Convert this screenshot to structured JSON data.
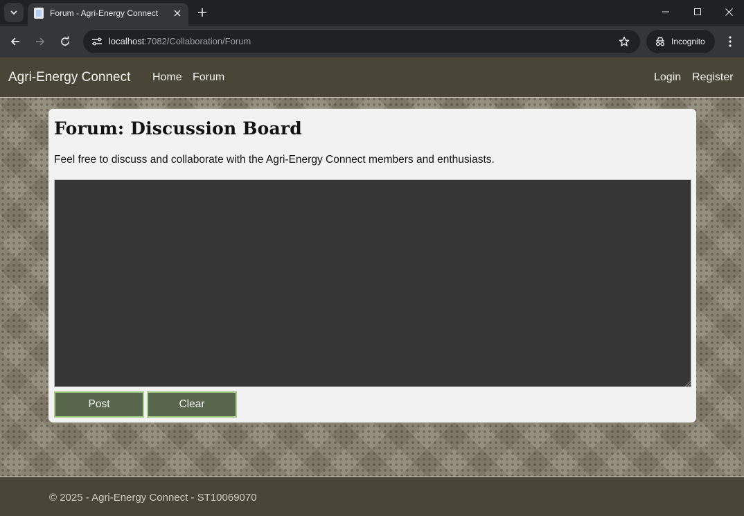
{
  "browser": {
    "tab_title": "Forum - Agri-Energy Connect",
    "url_host": "localhost",
    "url_rest": ":7082/Collaboration/Forum",
    "incognito_label": "Incognito"
  },
  "site": {
    "brand": "Agri-Energy Connect",
    "nav_left": [
      "Home",
      "Forum"
    ],
    "nav_right": [
      "Login",
      "Register"
    ]
  },
  "main": {
    "title": "Forum: Discussion Board",
    "intro": "Feel free to discuss and collaborate with the Agri-Energy Connect members and enthusiasts.",
    "post_value": "",
    "post_label": "Post",
    "clear_label": "Clear"
  },
  "footer": {
    "text": "© 2025 - Agri-Energy Connect - ST10069070"
  },
  "colors": {
    "navbar": "#4a4637",
    "background": "#8c8574",
    "card": "#f2f2f2",
    "textarea": "#363636",
    "button": "#58674c",
    "button_border": "#a8cf8f"
  }
}
